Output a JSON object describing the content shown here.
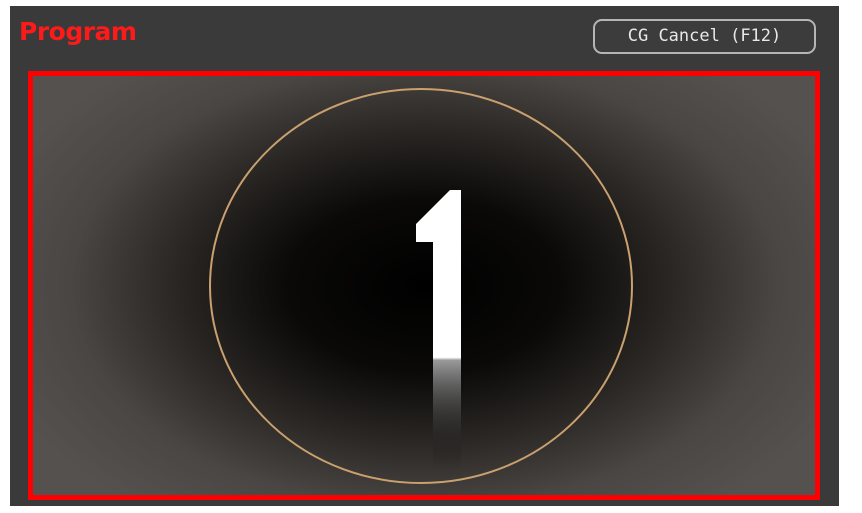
{
  "panel": {
    "title": "Program",
    "cg_cancel_label": "CG Cancel (F12)",
    "title_color": "#ff1a1a",
    "border_color": "#ff0000"
  },
  "countdown": {
    "number": "1",
    "ring_color": "#c9a06e"
  }
}
